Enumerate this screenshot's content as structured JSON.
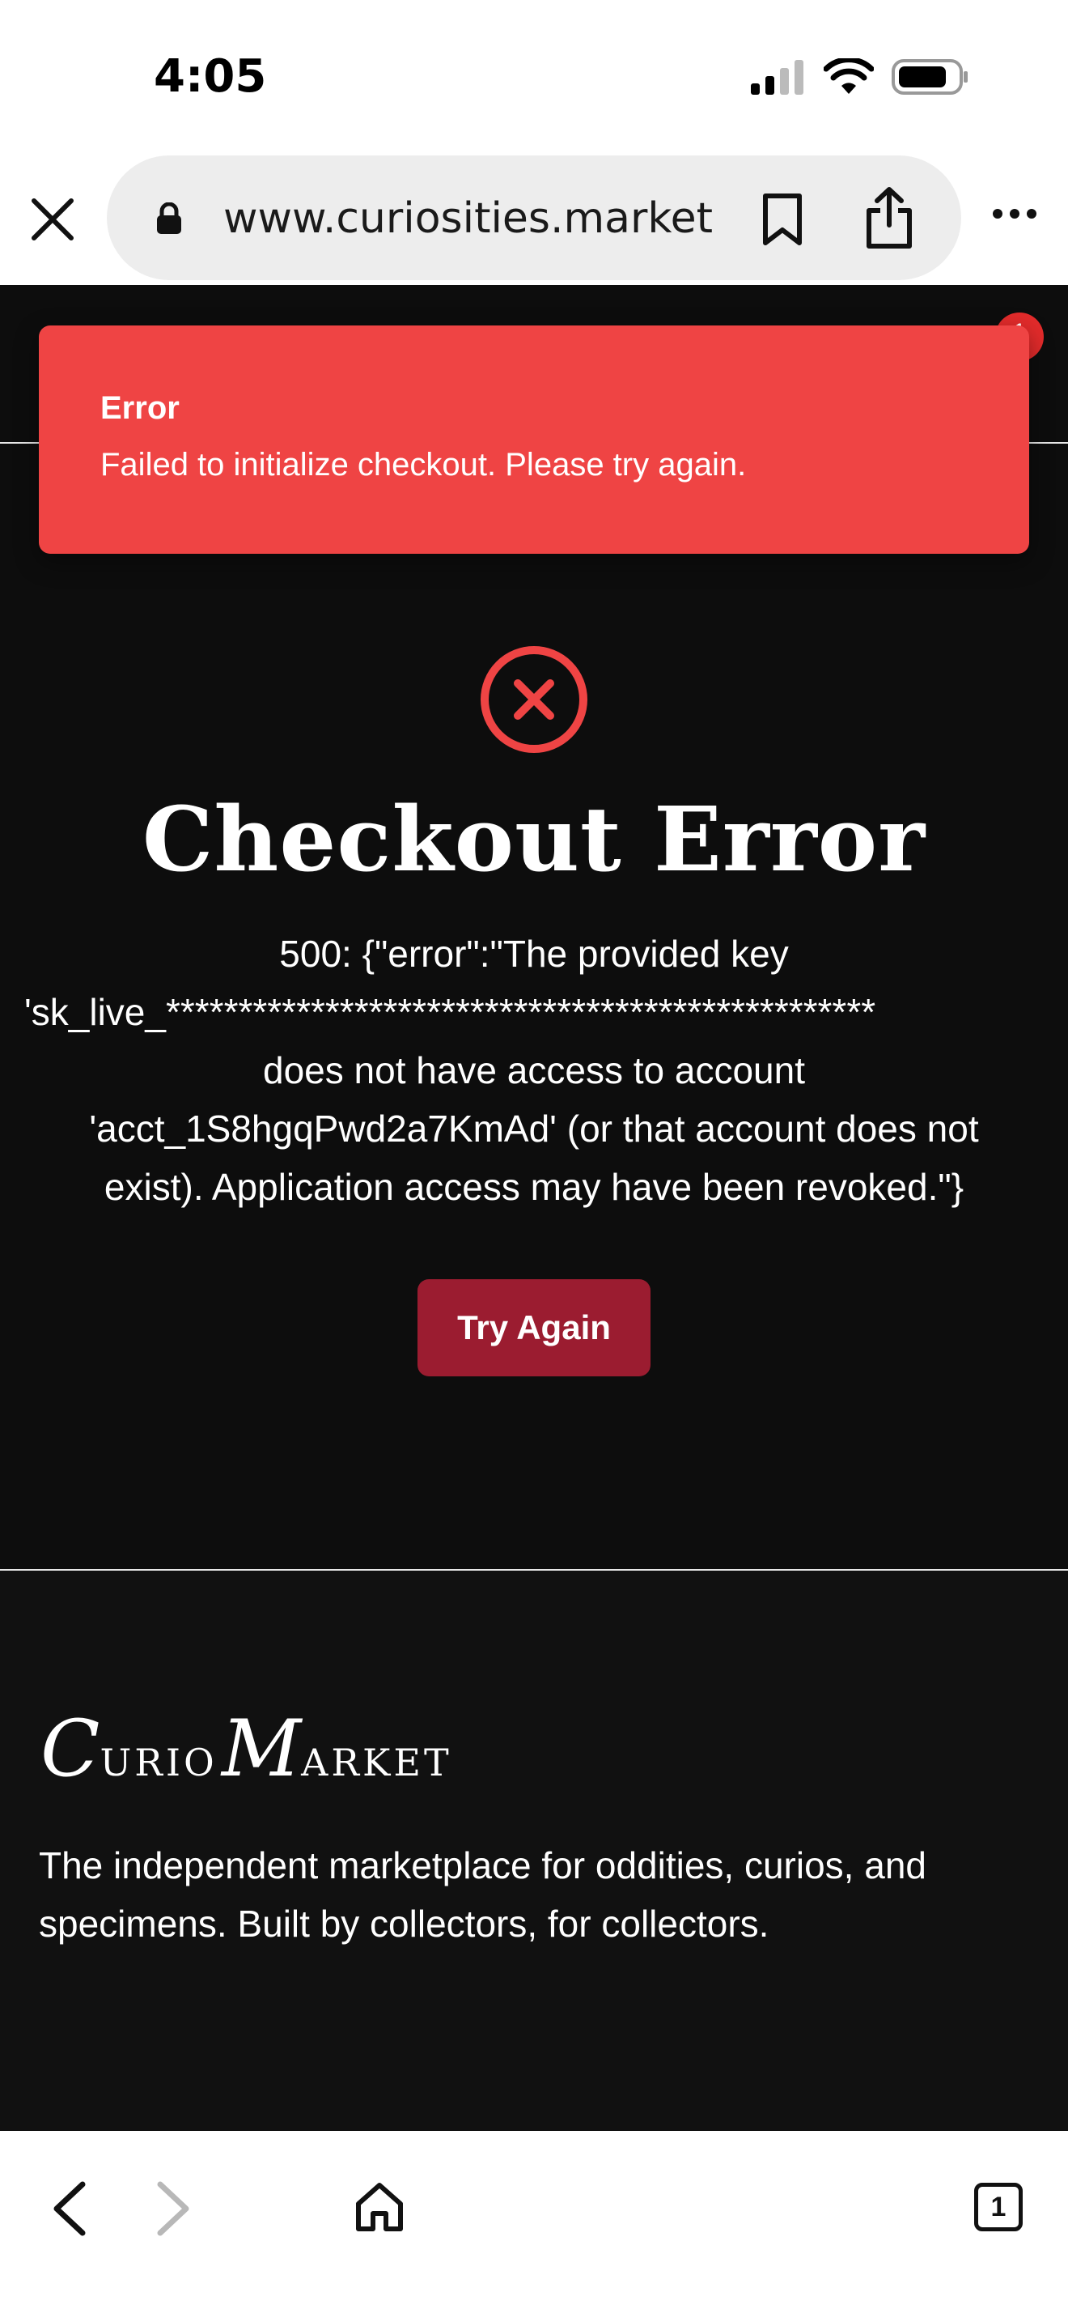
{
  "status_bar": {
    "time": "4:05"
  },
  "browser": {
    "url": "www.curiosities.market",
    "icons": [
      "close-icon",
      "lock-icon",
      "bookmark-icon",
      "share-icon",
      "more-icon"
    ]
  },
  "header": {
    "cart_badge": "1"
  },
  "toast": {
    "title": "Error",
    "message": "Failed to initialize checkout. Please try again."
  },
  "error": {
    "icon": "error-x-circle-icon",
    "heading": "Checkout Error",
    "detail_lines": [
      "500: {\"error\":\"The provided key",
      "'sk_live_*************************************************",
      "does not have access to account",
      "'acct_1S8hgqPwd2a7KmAd' (or that account does not",
      "exist). Application access may have been revoked.\"}"
    ],
    "retry_label": "Try Again"
  },
  "footer": {
    "logo_first_initial": "C",
    "logo_first_rest": "URIO",
    "logo_second_initial": "M",
    "logo_second_rest": "ARKET",
    "tagline": "The independent marketplace for oddities, curios, and specimens. Built by collectors, for collectors."
  },
  "bottom_bar": {
    "tab_count": "1"
  },
  "colors": {
    "toast": "#ef4444",
    "retry_button": "#9b1c30",
    "page_bg": "#0d0d0d",
    "error_icon": "#ef4444"
  }
}
